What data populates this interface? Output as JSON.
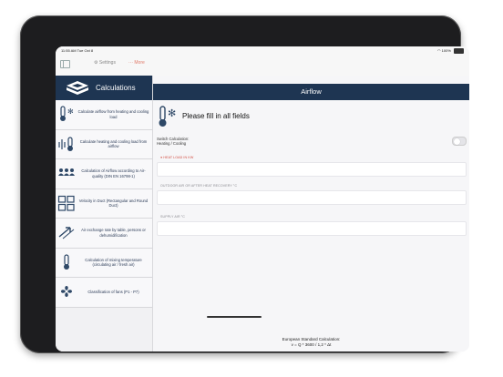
{
  "status": {
    "time": "11:55 AM",
    "date": "Tue Oct 8",
    "battery": "100%"
  },
  "topbar": {
    "settings_label": "⚙ Settings",
    "more_label": "··· More"
  },
  "sidebar": {
    "title": "Calculations",
    "items": [
      {
        "label": "Calculate airflow from heating and cooling load",
        "icon": "thermometer-snowflake-icon"
      },
      {
        "label": "Calculate heating and cooling load from airflow",
        "icon": "airflow-thermometer-icon"
      },
      {
        "label": "Calculation of Airflow according to Air-quality (DIN EN 16798-1)",
        "icon": "people-icon"
      },
      {
        "label": "Velocity in Duct (Rectangular and Round Duct)",
        "icon": "duct-grid-icon"
      },
      {
        "label": "Air exchange rate by table, persons or dehumidification",
        "icon": "air-arrows-icon"
      },
      {
        "label": "Calculation of mixing temperature (circulating air / fresh air)",
        "icon": "mixing-thermometer-icon"
      },
      {
        "label": "Classification of fans (P1 - P7)",
        "icon": "fan-icon"
      }
    ]
  },
  "main": {
    "header": "Airflow",
    "instruction": "Please fill in all fields",
    "switch_label": "Switch Calculation:",
    "switch_value": "Heating / Cooling",
    "switch_on": false,
    "fields": [
      {
        "label": "HEAT LOAD IN KW",
        "required": true,
        "value": ""
      },
      {
        "label": "OUTDOOR AIR OR AFTER HEAT RECOVERY °C",
        "required": false,
        "value": ""
      },
      {
        "label": "SUPPLY AIR °C",
        "required": false,
        "value": ""
      }
    ],
    "footer_line1": "European Standard Calculation:",
    "footer_line2": "v = Q * 3600 / 1,2 * Δt"
  },
  "colors": {
    "navy": "#1e3552",
    "accent_red": "#d24a3e"
  }
}
